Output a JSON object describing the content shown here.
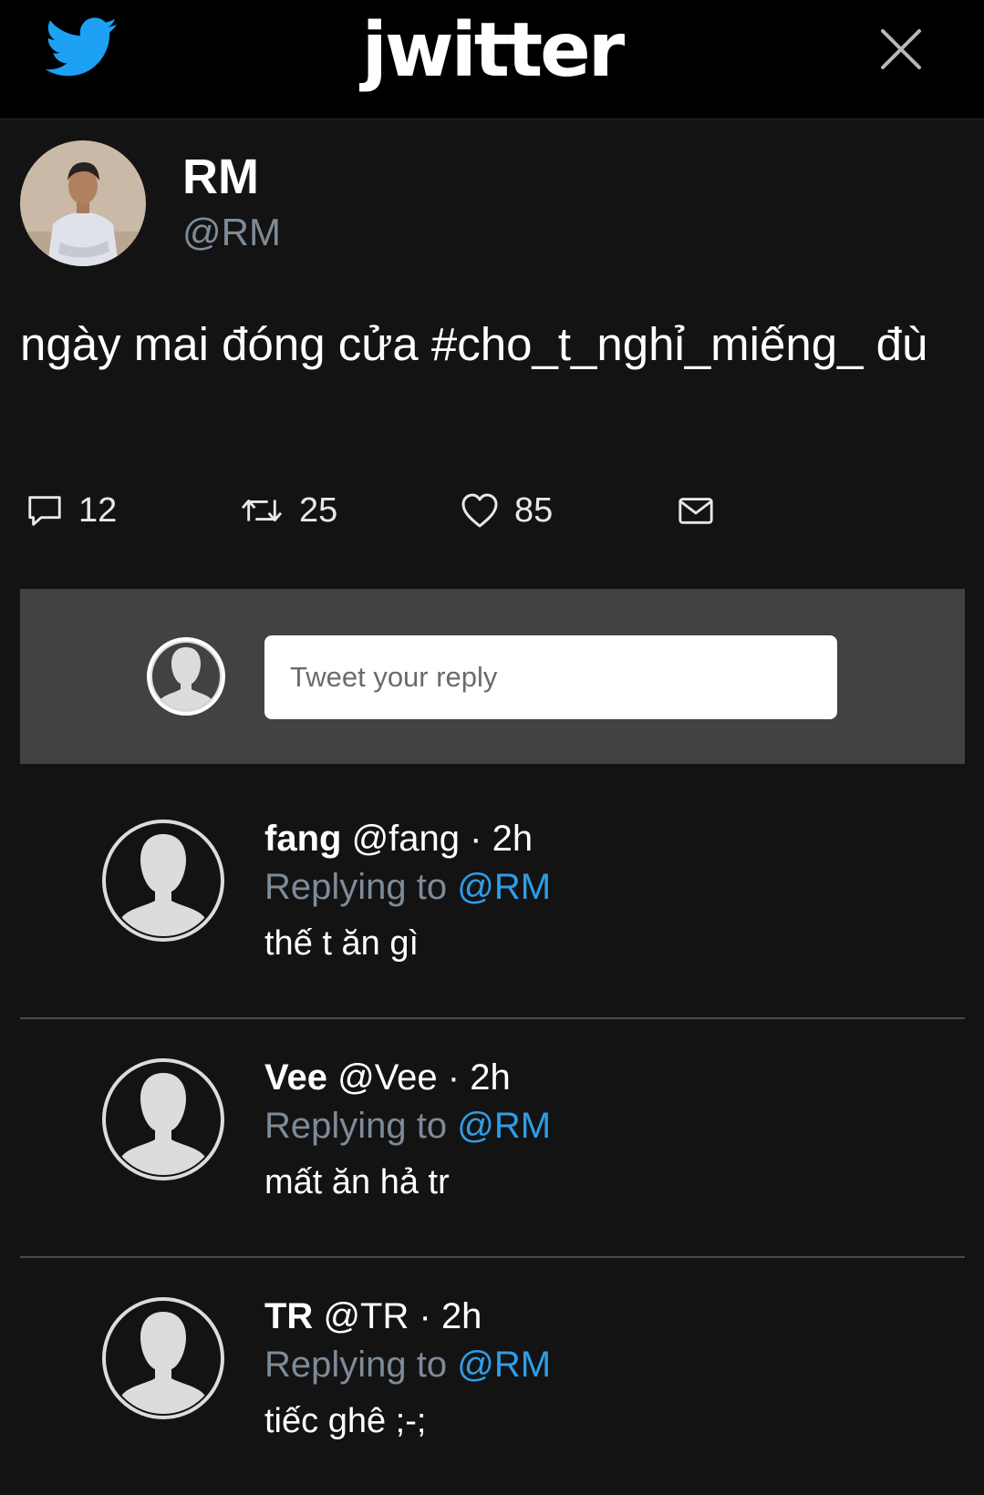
{
  "header": {
    "brand": "jwitter",
    "logo_icon": "bird-icon",
    "close_icon": "close-icon",
    "colors": {
      "bar": "#000000",
      "logo": "#1da1f2"
    }
  },
  "tweet": {
    "author_name": "RM",
    "author_handle": "@RM",
    "text": "ngày mai đóng cửa #cho_t_nghỉ_miếng_ đù",
    "actions": {
      "reply_count": "12",
      "retweet_count": "25",
      "like_count": "85"
    }
  },
  "composer": {
    "placeholder": "Tweet your reply"
  },
  "replies": [
    {
      "name": "fang",
      "handle": "@fang",
      "sep": " · ",
      "time": "2h",
      "replying_label": "Replying to",
      "mention": "@RM",
      "text": "thế t ăn gì"
    },
    {
      "name": "Vee",
      "handle": "@Vee",
      "sep": " · ",
      "time": "2h",
      "replying_label": "Replying to",
      "mention": "@RM",
      "text": "mất ăn hả tr"
    },
    {
      "name": "TR",
      "handle": "@TR",
      "sep": " · ",
      "time": "2h",
      "replying_label": "Replying to",
      "mention": "@RM",
      "text": "tiếc ghê ;-;"
    }
  ],
  "colors": {
    "background": "#131313",
    "composer_bg": "#424242",
    "handle_gray": "#7d8b99",
    "mention_blue": "#2f9de8"
  }
}
